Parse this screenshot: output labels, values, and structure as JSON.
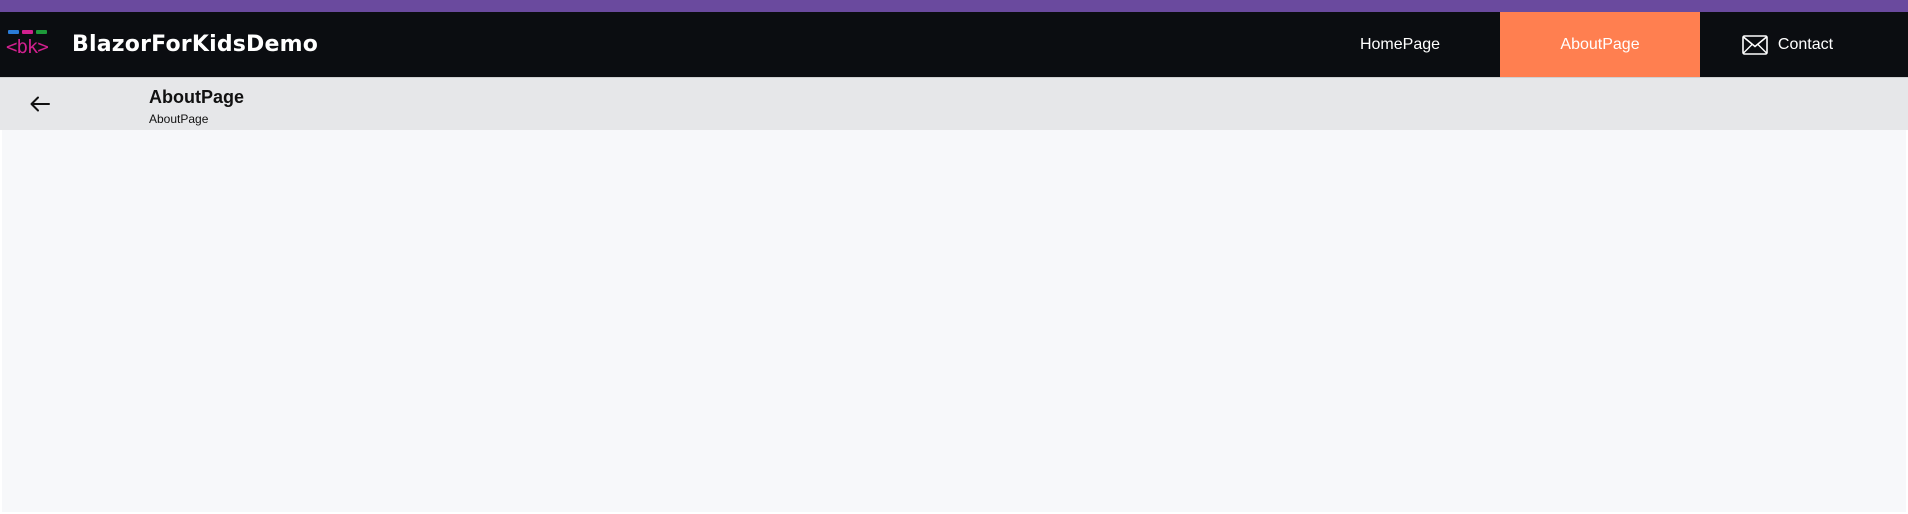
{
  "brand": {
    "logo_text": "<bk>",
    "title": "BlazorForKidsDemo"
  },
  "nav": {
    "items": [
      {
        "label": "HomePage",
        "active": false
      },
      {
        "label": "AboutPage",
        "active": true
      },
      {
        "label": "Contact",
        "active": false,
        "icon": "mail-icon"
      }
    ]
  },
  "subheader": {
    "back_icon": "arrow-left-icon",
    "title": "AboutPage",
    "subtitle": "AboutPage"
  },
  "colors": {
    "accent_bar": "#6a4a9e",
    "navbar_bg": "#0b0d11",
    "active_nav": "#ff7f50",
    "subheader_bg": "#e6e7e9",
    "content_bg": "#f7f8fa",
    "logo_blue": "#2a7cd7",
    "logo_magenta": "#d1208e",
    "logo_green": "#1e9a3a"
  }
}
